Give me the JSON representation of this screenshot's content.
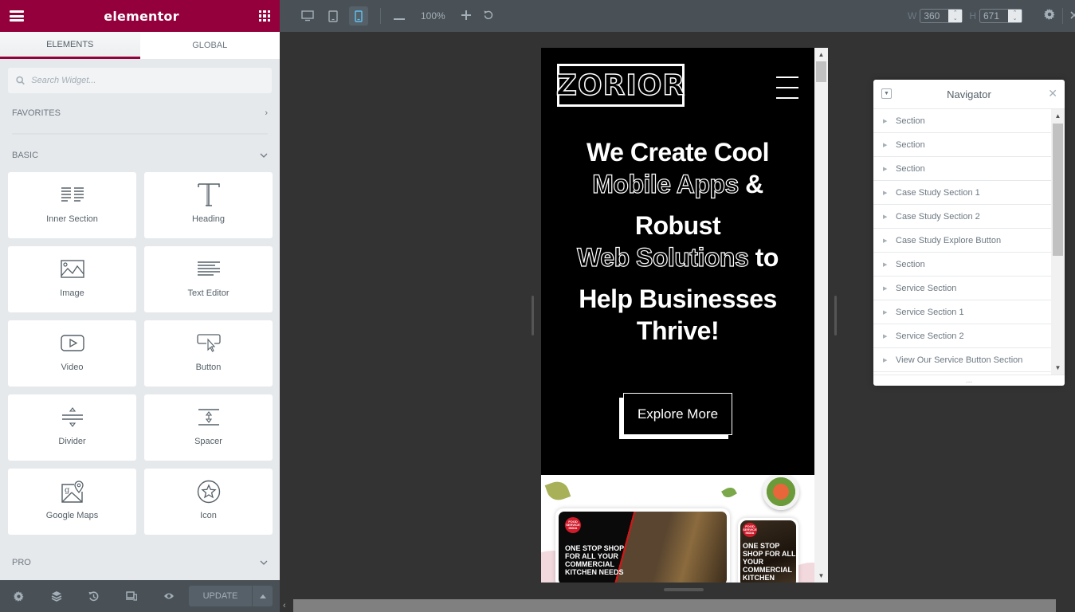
{
  "panel": {
    "brand": "elementor",
    "tabs": [
      {
        "label": "ELEMENTS",
        "active": true
      },
      {
        "label": "GLOBAL",
        "active": false
      }
    ],
    "search": {
      "placeholder": "Search Widget...",
      "value": ""
    },
    "categories": {
      "favorites": "FAVORITES",
      "basic": "BASIC",
      "pro": "PRO"
    },
    "widgets": [
      {
        "label": "Inner Section",
        "icon": "inner-section-icon"
      },
      {
        "label": "Heading",
        "icon": "heading-icon"
      },
      {
        "label": "Image",
        "icon": "image-icon"
      },
      {
        "label": "Text Editor",
        "icon": "text-editor-icon"
      },
      {
        "label": "Video",
        "icon": "video-icon"
      },
      {
        "label": "Button",
        "icon": "button-icon"
      },
      {
        "label": "Divider",
        "icon": "divider-icon"
      },
      {
        "label": "Spacer",
        "icon": "spacer-icon"
      },
      {
        "label": "Google Maps",
        "icon": "google-maps-icon"
      },
      {
        "label": "Icon",
        "icon": "star-icon"
      }
    ],
    "footer": {
      "update_label": "UPDATE"
    },
    "colors": {
      "brand": "#93003c",
      "footer": "#495157"
    }
  },
  "topbar": {
    "zoom": "100%",
    "width_label": "W",
    "width_value": "360",
    "height_label": "H",
    "height_value": "671",
    "active_device": "mobile"
  },
  "site": {
    "logo_text": "ZORIOR",
    "hero": {
      "line1": "We Create Cool",
      "outline1": "Mobile Apps",
      "after1": " &",
      "line2": "Robust",
      "outline2": "Web Solutions",
      "after2": " to",
      "line3": "Help Businesses Thrive!"
    },
    "cta": "Explore More",
    "showcase": {
      "badge": "FOOD SERVICE INDIA",
      "tablet_text": "ONE STOP SHOP FOR ALL YOUR COMMERCIAL KITCHEN NEEDS",
      "phone_text": "ONE STOP SHOP FOR ALL YOUR COMMERCIAL KITCHEN"
    }
  },
  "navigator": {
    "title": "Navigator",
    "items": [
      "Section",
      "Section",
      "Section",
      "Case Study Section 1",
      "Case Study Section 2",
      "Case Study Explore Button",
      "Section",
      "Service Section",
      "Service Section 1",
      "Service Section 2",
      "View Our Service Button Section"
    ],
    "footer_handle": "..."
  }
}
